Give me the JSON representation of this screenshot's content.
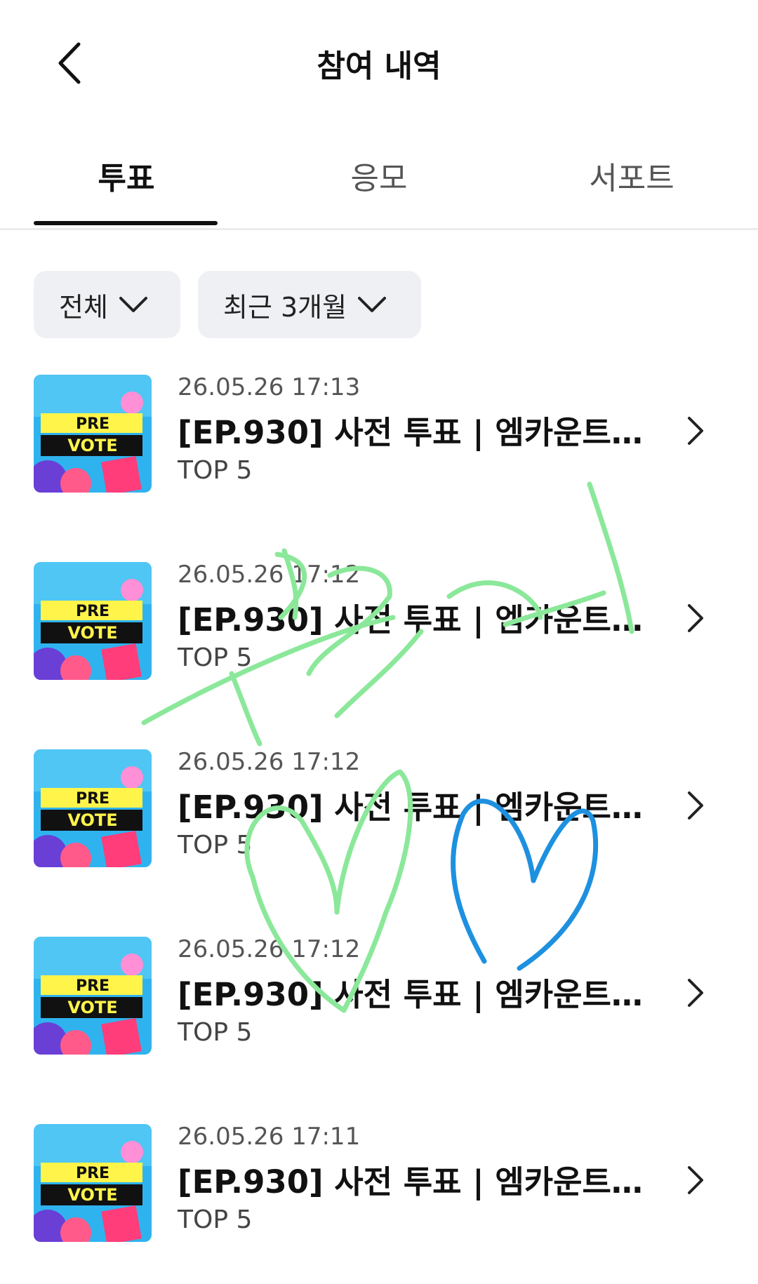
{
  "header": {
    "title": "참여 내역"
  },
  "tabs": [
    {
      "label": "투표",
      "active": true
    },
    {
      "label": "응모",
      "active": false
    },
    {
      "label": "서포트",
      "active": false
    }
  ],
  "filters": {
    "type": "전체",
    "period": "최근 3개월"
  },
  "items": [
    {
      "thumb_top": "PRE",
      "thumb_bottom": "VOTE",
      "date": "26.05.26 17:13",
      "title": "[EP.930] 사전 투표 | 엠카운트다...",
      "rank": "TOP 5"
    },
    {
      "thumb_top": "PRE",
      "thumb_bottom": "VOTE",
      "date": "26.05.26 17:12",
      "title": "[EP.930] 사전 투표 | 엠카운트다...",
      "rank": "TOP 5"
    },
    {
      "thumb_top": "PRE",
      "thumb_bottom": "VOTE",
      "date": "26.05.26 17:12",
      "title": "[EP.930] 사전 투표 | 엠카운트다...",
      "rank": "TOP 5"
    },
    {
      "thumb_top": "PRE",
      "thumb_bottom": "VOTE",
      "date": "26.05.26 17:12",
      "title": "[EP.930] 사전 투표 | 엠카운트다...",
      "rank": "TOP 5"
    },
    {
      "thumb_top": "PRE",
      "thumb_bottom": "VOTE",
      "date": "26.05.26 17:11",
      "title": "[EP.930] 사전 투표 | 엠카운트다...",
      "rank": "TOP 5"
    }
  ],
  "colors": {
    "scribble_green": "#8be89a",
    "scribble_blue": "#1e90e0",
    "tab_underline": "#111111",
    "filter_bg": "#eef0f3"
  }
}
